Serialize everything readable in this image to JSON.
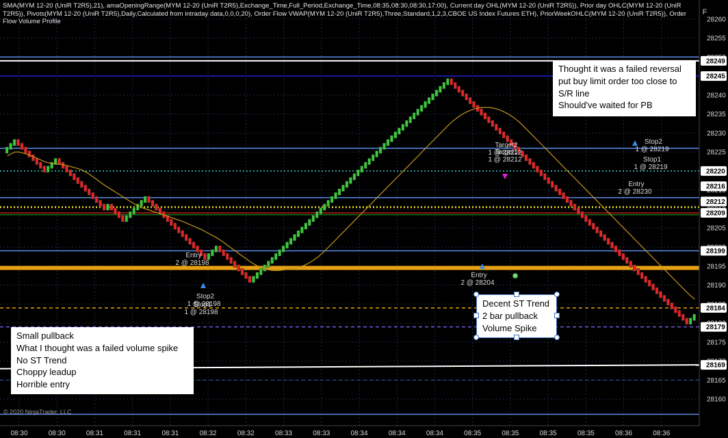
{
  "indicator_header": "SMA(MYM 12-20 (UniR T2R5),21), amaOpeningRange(MYM 12-20 (UniR T2R5),Exchange_Time,Full_Period,Exchange_Time,08:35,08:30,08:30,17:00), Current day OHL(MYM 12-20 (UniR T2R5)), Prior day OHLC(MYM 12-20 (UniR T2R5)), Pivots(MYM 12-20 (UniR T2R5),Daily,Calculated from intraday data,0,0,0,20), Order Flow VWAP(MYM 12-20 (UniR T2R5),Three,Standard,1,2,3,CBOE US Index Futures ETH), PriorWeekOHLC(MYM 12-20 (UniR T2R5)), Order Flow Volume Profile",
  "copyright": "© 2020 NinjaTrader, LLC",
  "top_right_button": "F",
  "colors": {
    "background": "#000000",
    "up_bar": "#3cc83c",
    "down_bar": "#e02828",
    "sma": "#c8961e",
    "grid": "#1e2a44",
    "level_blue": "#5a8ce6",
    "level_gold": "#e6a014"
  },
  "notes": [
    {
      "id": "note-top-right",
      "lines": [
        "Thought it was a failed reversal",
        "put buy limit  order too close to",
        "S/R line",
        "Should've waited for PB"
      ]
    },
    {
      "id": "note-middle",
      "lines": [
        "Decent ST Trend",
        "2 bar pullback",
        "Volume Spike"
      ]
    },
    {
      "id": "note-bottom-left",
      "lines": [
        "Small pullback",
        "What I thought was a failed volume spike",
        "No ST Trend",
        "Choppy leadup",
        "Horrible entry"
      ]
    }
  ],
  "chart_data": {
    "type": "candlestick",
    "instrument": "MYM 12-20 (UniR T2R5)",
    "ylim": [
      28153,
      28265
    ],
    "y_ticks": [
      28160,
      28165,
      28170,
      28175,
      28180,
      28185,
      28190,
      28195,
      28200,
      28205,
      28210,
      28215,
      28220,
      28225,
      28230,
      28235,
      28240,
      28245,
      28250,
      28255,
      28260
    ],
    "highlighted_prices": [
      {
        "label": "28249",
        "color": "#ffffff"
      },
      {
        "label": "28245",
        "color": "#ffffff"
      },
      {
        "label": "28220",
        "color": "#ffffff"
      },
      {
        "label": "28216",
        "color": "#ffffff"
      },
      {
        "label": "28212",
        "color": "#ffffff"
      },
      {
        "label": "28209",
        "color": "#ffffff"
      },
      {
        "label": "28199",
        "color": "#ffffff"
      },
      {
        "label": "28184",
        "color": "#ffffff"
      },
      {
        "label": "28179",
        "color": "#ffffff"
      },
      {
        "label": "28169",
        "color": "#ffffff"
      }
    ],
    "x_labels": [
      "08:30",
      "08:30",
      "08:31",
      "08:31",
      "08:31",
      "08:32",
      "08:32",
      "08:33",
      "08:33",
      "08:34",
      "08:34",
      "08:34",
      "08:35",
      "08:35",
      "08:35",
      "08:35",
      "08:36",
      "08:36"
    ],
    "levels": [
      {
        "name": "prior-day-high",
        "price": 28250,
        "color": "#5a8ce6",
        "style": "solid",
        "width": 1.5
      },
      {
        "name": "white-level-upper",
        "price": 28249,
        "color": "#ffffff",
        "style": "solid",
        "width": 2
      },
      {
        "name": "navy-level",
        "price": 28245,
        "color": "#1a1aa0",
        "style": "solid",
        "width": 2
      },
      {
        "name": "blue-level",
        "price": 28226,
        "color": "#5a8ce6",
        "style": "solid",
        "width": 1.5
      },
      {
        "name": "cyan-dotted",
        "price": 28220,
        "color": "#40d0d0",
        "style": "dotted",
        "width": 1.5
      },
      {
        "name": "blue-level-2",
        "price": 28213,
        "color": "#5a8ce6",
        "style": "solid",
        "width": 1.5
      },
      {
        "name": "yellow-dotted",
        "price": 28210.5,
        "color": "#e6e628",
        "style": "dotted",
        "width": 2.5
      },
      {
        "name": "red-level",
        "price": 28209,
        "color": "#c02020",
        "style": "solid",
        "width": 1.5
      },
      {
        "name": "green-level",
        "price": 28208.5,
        "color": "#1a8a1a",
        "style": "solid",
        "width": 1.2
      },
      {
        "name": "blue-level-3",
        "price": 28199,
        "color": "#5a8ce6",
        "style": "solid",
        "width": 1.5
      },
      {
        "name": "gold-band",
        "price": 28194.5,
        "color": "#e6a014",
        "style": "solid",
        "width": 6
      },
      {
        "name": "orange-dashed",
        "price": 28184,
        "color": "#e6a014",
        "style": "dashed",
        "width": 1.5
      },
      {
        "name": "purple-dashed",
        "price": 28179,
        "color": "#7a5ae6",
        "style": "dashed",
        "width": 1.5
      },
      {
        "name": "blue-dashed",
        "price": 28165,
        "color": "#3a5ab0",
        "style": "dashed",
        "width": 1
      },
      {
        "name": "blue-bottom",
        "price": 28156,
        "color": "#5a8ce6",
        "style": "solid",
        "width": 1.5
      }
    ],
    "white_sloped_line": {
      "price_start": 28168,
      "price_end": 28169,
      "color": "#ffffff"
    },
    "bar_count": 191,
    "bars_close": [
      28226,
      28227,
      28228,
      28227,
      28226,
      28225,
      28224,
      28223,
      28222,
      28221,
      28220,
      28221,
      28222,
      28223,
      28222,
      28221,
      28220,
      28219,
      28218,
      28217,
      28216,
      28215,
      28214,
      28213,
      28212,
      28211,
      28210,
      28211,
      28210,
      28209,
      28208,
      28207,
      28208,
      28209,
      28210,
      28211,
      28212,
      28213,
      28212,
      28211,
      28210,
      28209,
      28208,
      28207,
      28206,
      28205,
      28204,
      28203,
      28202,
      28201,
      28200,
      28199,
      28198,
      28197,
      28198,
      28199,
      28200,
      28199,
      28198,
      28197,
      28196,
      28195,
      28194,
      28193,
      28192,
      28191,
      28192,
      28193,
      28194,
      28195,
      28196,
      28197,
      28198,
      28199,
      28200,
      28201,
      28202,
      28203,
      28204,
      28205,
      28206,
      28207,
      28208,
      28209,
      28210,
      28211,
      28212,
      28213,
      28214,
      28215,
      28216,
      28217,
      28218,
      28219,
      28220,
      28221,
      28222,
      28223,
      28224,
      28225,
      28226,
      28227,
      28228,
      28229,
      28230,
      28231,
      28232,
      28233,
      28234,
      28235,
      28236,
      28237,
      28238,
      28239,
      28240,
      28241,
      28242,
      28243,
      28244,
      28243,
      28242,
      28241,
      28240,
      28239,
      28238,
      28237,
      28236,
      28235,
      28234,
      28233,
      28232,
      28231,
      28230,
      28229,
      28228,
      28227,
      28226,
      28225,
      28224,
      28223,
      28222,
      28221,
      28220,
      28219,
      28218,
      28217,
      28216,
      28215,
      28214,
      28213,
      28212,
      28211,
      28210,
      28209,
      28208,
      28207,
      28206,
      28205,
      28204,
      28203,
      28202,
      28201,
      28200,
      28199,
      28198,
      28197,
      28196,
      28195,
      28194,
      28193,
      28192,
      28191,
      28190,
      28189,
      28188,
      28187,
      28186,
      28185,
      28184,
      28183,
      28182,
      28181,
      28180,
      28181,
      28182
    ],
    "trade_markers": [
      {
        "label": "Target2",
        "price_label": "1 @ 28212"
      },
      {
        "label": "Target1",
        "price_label": "1 @ 28212"
      },
      {
        "label": "Stop2",
        "price_label": "1 @ 28219"
      },
      {
        "label": "Stop1",
        "price_label": "1 @ 28219"
      },
      {
        "label": "Entry",
        "price_label": "2 @ 28230"
      },
      {
        "label": "Entry",
        "price_label": "2 @ 28198"
      },
      {
        "label": "Stop2",
        "price_label": "1 @ 28198"
      },
      {
        "label": "Stop1",
        "price_label": "1 @ 28198"
      },
      {
        "label": "Entry",
        "price_label": "2 @ 28204"
      }
    ]
  }
}
